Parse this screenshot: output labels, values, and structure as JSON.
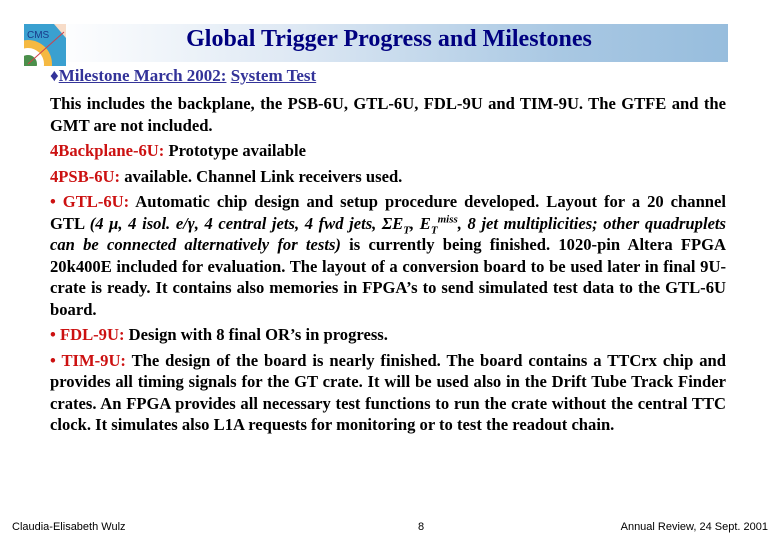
{
  "slide": {
    "title": "Global Trigger Progress and Milestones",
    "logo_label": "CMS",
    "heading": {
      "bullet": "♦",
      "label": "Milestone March 2002:",
      "value": "System Test"
    },
    "intro": "This includes the backplane, the PSB-6U, GTL-6U, FDL-9U and TIM-9U. The GTFE and the GMT are not included.",
    "items": [
      {
        "marker": "4",
        "label": "Backplane-6U:",
        "text": " Prototype available"
      },
      {
        "marker": "4",
        "label": "PSB-6U:",
        "text": " available. Channel Link receivers used."
      }
    ],
    "gtl": {
      "marker": "• ",
      "label": "GTL-6U:",
      "text1": " Automatic chip design and setup procedure developed. Layout for a 20 channel GTL ",
      "italic_a": "(4 μ, 4 isol. e/γ, 4 central jets, 4 fwd jets, ΣE",
      "sub_t": "T",
      "italic_b": ", E",
      "sub_t2": "T",
      "sup_miss": "miss",
      "italic_c": ", 8 jet multiplicities; other quadruplets can be connected alternatively for tests)",
      "text2": " is currently being finished. 1020-pin Altera FPGA 20k400E included for evaluation. The layout of a conversion board to be used later in final 9U-crate is ready. It contains also memories in FPGA’s to send simulated test data to the GTL-6U board."
    },
    "fdl": {
      "marker": "• ",
      "label": "FDL-9U:",
      "text": " Design with 8 final OR’s in progress."
    },
    "tim": {
      "marker": "• ",
      "label": "TIM-9U:",
      "text": " The design of the board is nearly finished. The board contains a TTCrx chip and provides all timing signals for the GT crate. It will be used also in the Drift Tube Track Finder crates. An FPGA provides all necessary test functions to run the crate without the central TTC clock. It simulates also L1A requests for monitoring or to test the readout chain."
    },
    "footer": {
      "author": "Claudia-Elisabeth Wulz",
      "page": "8",
      "event": "Annual Review, 24 Sept. 2001"
    }
  }
}
